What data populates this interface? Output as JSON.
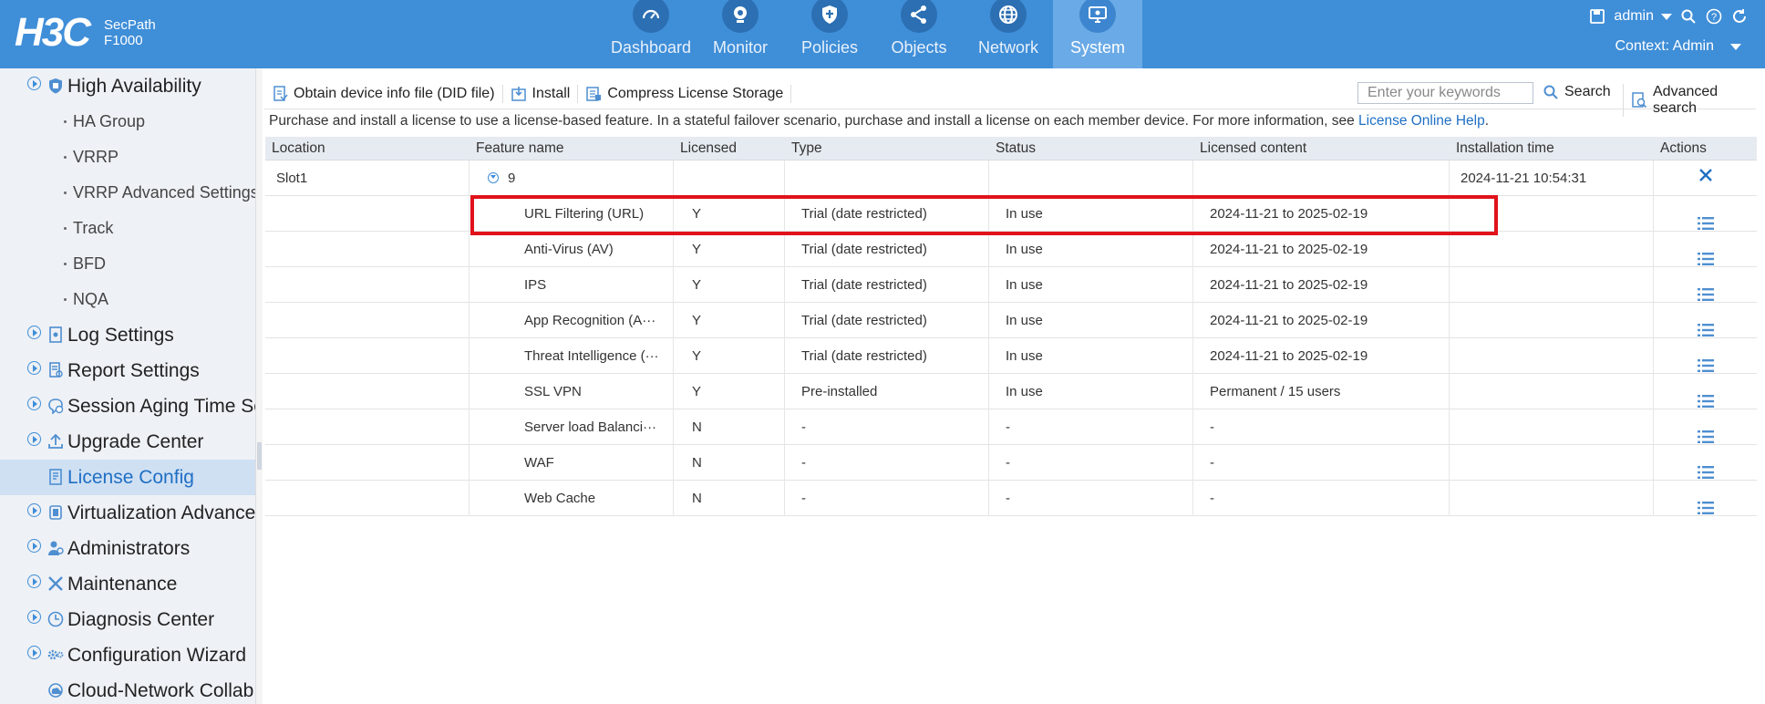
{
  "header": {
    "brand": "H3C",
    "product_line": "SecPath",
    "model": "F1000",
    "nav_tabs": [
      {
        "label": "Dashboard",
        "icon": "gauge-icon"
      },
      {
        "label": "Monitor",
        "icon": "camera-icon"
      },
      {
        "label": "Policies",
        "icon": "shield-icon"
      },
      {
        "label": "Objects",
        "icon": "share-icon"
      },
      {
        "label": "Network",
        "icon": "globe-icon"
      },
      {
        "label": "System",
        "icon": "monitor-icon",
        "active": true
      }
    ],
    "user": "admin",
    "context": "Context: Admin"
  },
  "sidebar": {
    "items": [
      {
        "label": "High Availability",
        "type": "group",
        "icon": "shield-icon"
      },
      {
        "label": "HA Group",
        "type": "sub"
      },
      {
        "label": "VRRP",
        "type": "sub"
      },
      {
        "label": "VRRP Advanced Settings",
        "type": "sub"
      },
      {
        "label": "Track",
        "type": "sub"
      },
      {
        "label": "BFD",
        "type": "sub"
      },
      {
        "label": "NQA",
        "type": "sub"
      },
      {
        "label": "Log Settings",
        "type": "group",
        "icon": "log-icon"
      },
      {
        "label": "Report Settings",
        "type": "group",
        "icon": "report-icon"
      },
      {
        "label": "Session Aging Time Se",
        "type": "group",
        "icon": "session-icon"
      },
      {
        "label": "Upgrade Center",
        "type": "group",
        "icon": "upload-icon"
      },
      {
        "label": "License Config",
        "type": "leaf",
        "icon": "license-icon",
        "active": true
      },
      {
        "label": "Virtualization Advance",
        "type": "group",
        "icon": "virtualization-icon"
      },
      {
        "label": "Administrators",
        "type": "group",
        "icon": "users-icon"
      },
      {
        "label": "Maintenance",
        "type": "group",
        "icon": "tools-icon"
      },
      {
        "label": "Diagnosis Center",
        "type": "group",
        "icon": "clock-icon"
      },
      {
        "label": "Configuration Wizard",
        "type": "group",
        "icon": "gear-icon"
      },
      {
        "label": "Cloud-Network Collab",
        "type": "leaf",
        "icon": "cloud-icon"
      }
    ]
  },
  "toolbar": {
    "obtain_label": "Obtain device info file (DID file)",
    "install_label": "Install",
    "compress_label": "Compress License Storage",
    "search_placeholder": "Enter your keywords",
    "search_label": "Search",
    "advanced_search_label": "Advanced search"
  },
  "notice": {
    "text": "Purchase and install a license to use a license-based feature. In a stateful failover scenario, purchase and install a license on each member device. For more information, see ",
    "link": "License Online Help",
    "suffix": "."
  },
  "table": {
    "columns": [
      "Location",
      "Feature name",
      "Licensed",
      "Type",
      "Status",
      "Licensed content",
      "Installation time",
      "Actions"
    ],
    "group_row": {
      "location": "Slot1",
      "count": "9",
      "installation_time": "2024-11-21 10:54:31"
    },
    "rows": [
      {
        "feature": "URL Filtering (URL)",
        "licensed": "Y",
        "type": "Trial (date restricted)",
        "status": "In use",
        "content": "2024-11-21 to 2025-02-19"
      },
      {
        "feature": "Anti-Virus (AV)",
        "licensed": "Y",
        "type": "Trial (date restricted)",
        "status": "In use",
        "content": "2024-11-21 to 2025-02-19"
      },
      {
        "feature": "IPS",
        "licensed": "Y",
        "type": "Trial (date restricted)",
        "status": "In use",
        "content": "2024-11-21 to 2025-02-19"
      },
      {
        "feature": "App Recognition (A···",
        "licensed": "Y",
        "type": "Trial (date restricted)",
        "status": "In use",
        "content": "2024-11-21 to 2025-02-19"
      },
      {
        "feature": "Threat Intelligence (···",
        "licensed": "Y",
        "type": "Trial (date restricted)",
        "status": "In use",
        "content": "2024-11-21 to 2025-02-19"
      },
      {
        "feature": "SSL VPN",
        "licensed": "Y",
        "type": "Pre-installed",
        "status": "In use",
        "content": "Permanent / 15 users"
      },
      {
        "feature": "Server load Balanci···",
        "licensed": "N",
        "type": "-",
        "status": "-",
        "content": "-"
      },
      {
        "feature": "WAF",
        "licensed": "N",
        "type": "-",
        "status": "-",
        "content": "-"
      },
      {
        "feature": "Web Cache",
        "licensed": "N",
        "type": "-",
        "status": "-",
        "content": "-"
      }
    ]
  },
  "colors": {
    "header_bg": "#3f8ed8",
    "active_tab": "#6aaae6",
    "highlight_border": "#e0121b",
    "link": "#1f6fc4"
  }
}
